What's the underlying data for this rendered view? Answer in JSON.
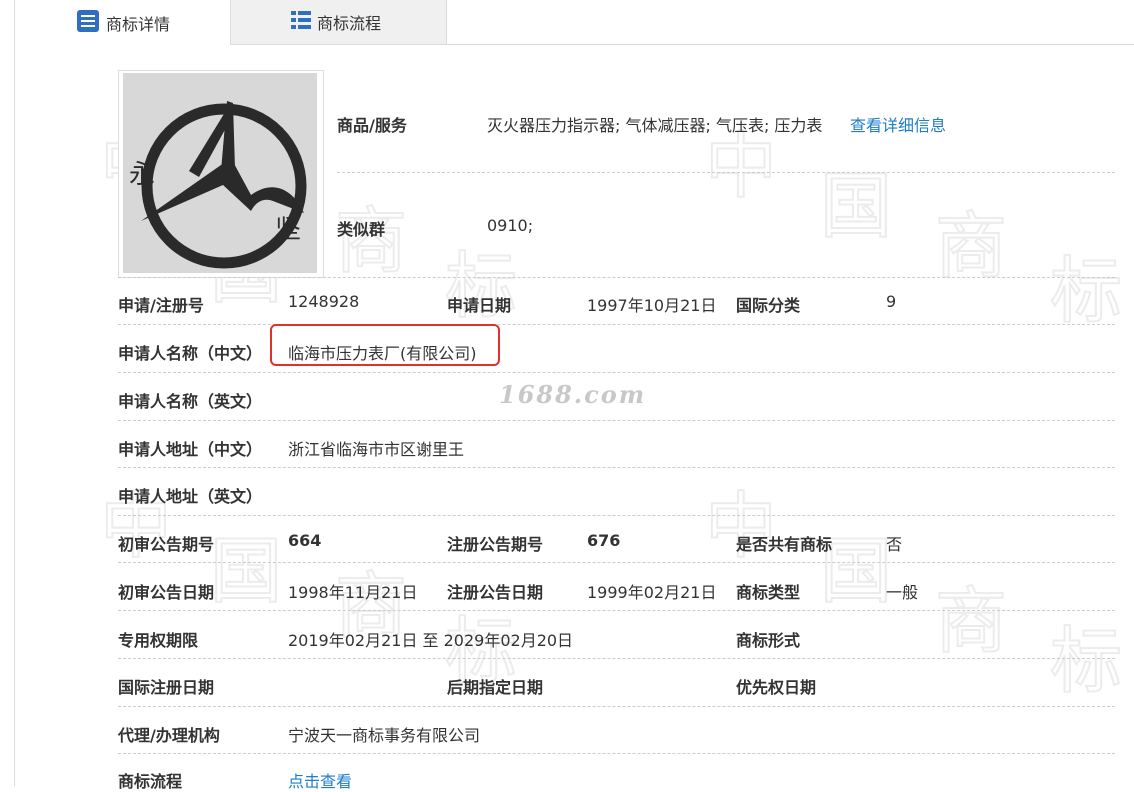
{
  "tabs": [
    {
      "label": "商标详情",
      "icon": "document-icon",
      "active": true
    },
    {
      "label": "商标流程",
      "icon": "list-icon",
      "active": false
    }
  ],
  "watermark": {
    "chars": [
      "中",
      "国",
      "商",
      "标"
    ],
    "site": "1688.com"
  },
  "logo": {
    "left_char": "永",
    "right_char": "坚"
  },
  "goods": {
    "label": "商品/服务",
    "value": "灭火器压力指示器; 气体减压器; 气压表; 压力表",
    "link": "查看详细信息"
  },
  "similar": {
    "label": "类似群",
    "value": "0910;"
  },
  "rows": {
    "reg_no": {
      "label": "申请/注册号",
      "value": "1248928"
    },
    "apply_date": {
      "label": "申请日期",
      "value": "1997年10月21日"
    },
    "intl_class": {
      "label": "国际分类",
      "value": "9"
    },
    "applicant_cn": {
      "label": "申请人名称（中文）",
      "value": "临海市压力表厂(有限公司)"
    },
    "applicant_en": {
      "label": "申请人名称（英文）",
      "value": ""
    },
    "address_cn": {
      "label": "申请人地址（中文）",
      "value": "浙江省临海市市区谢里王"
    },
    "address_en": {
      "label": "申请人地址（英文）",
      "value": ""
    },
    "prelim_no": {
      "label": "初审公告期号",
      "value": "664"
    },
    "reg_notice_no": {
      "label": "注册公告期号",
      "value": "676"
    },
    "shared": {
      "label": "是否共有商标",
      "value": "否"
    },
    "prelim_date": {
      "label": "初审公告日期",
      "value": "1998年11月21日"
    },
    "reg_notice_date": {
      "label": "注册公告日期",
      "value": "1999年02月21日"
    },
    "mark_type": {
      "label": "商标类型",
      "value": "一般"
    },
    "exclusive_period": {
      "label": "专用权期限",
      "value": "2019年02月21日 至 2029年02月20日"
    },
    "mark_form": {
      "label": "商标形式",
      "value": ""
    },
    "intl_reg_date": {
      "label": "国际注册日期",
      "value": ""
    },
    "later_date": {
      "label": "后期指定日期",
      "value": ""
    },
    "priority_date": {
      "label": "优先权日期",
      "value": ""
    },
    "agent": {
      "label": "代理/办理机构",
      "value": "宁波天一商标事务有限公司"
    },
    "process": {
      "label": "商标流程",
      "link": "点击查看"
    }
  },
  "colors": {
    "link": "#1e7dc8",
    "highlight": "#e0312b",
    "tab_inactive": "#f0f0f0",
    "icon": "#2f6fbf"
  }
}
